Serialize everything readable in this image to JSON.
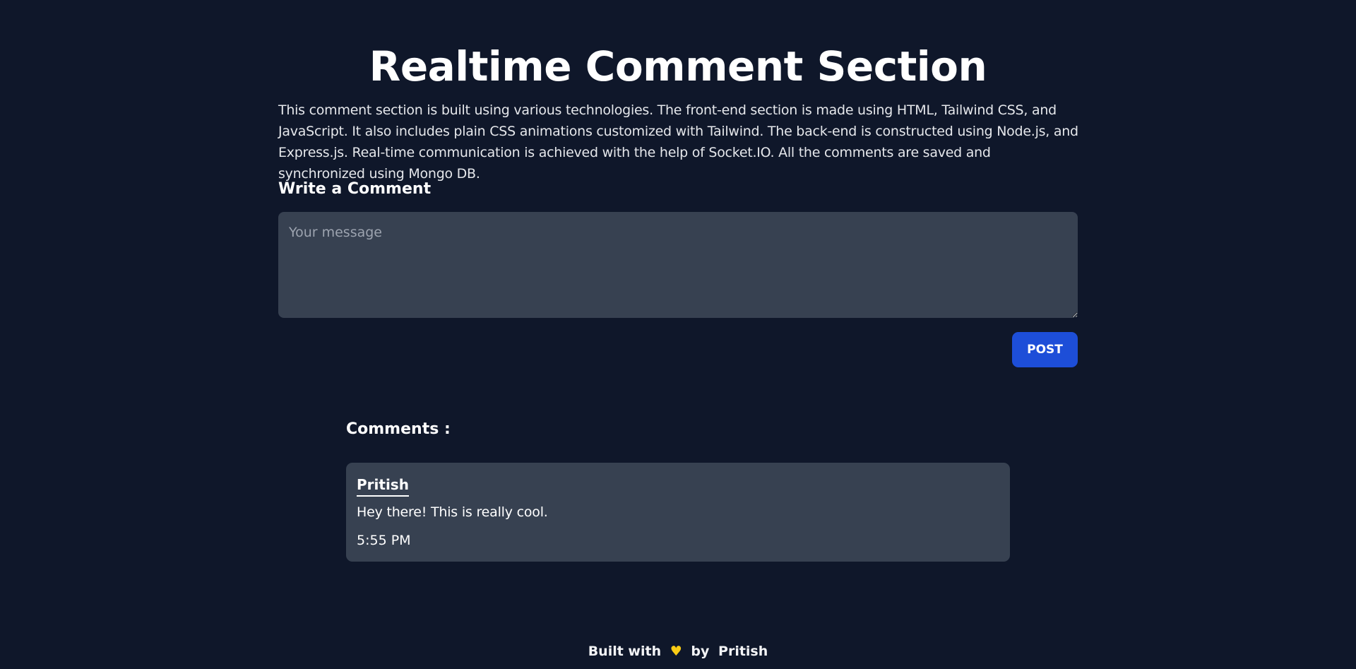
{
  "header": {
    "title": "Realtime Comment Section",
    "description": "This comment section is built using various technologies. The front-end section is made using HTML, Tailwind CSS, and JavaScript. It also includes plain CSS animations customized with Tailwind. The back-end is constructed using Node.js, and Express.js. Real-time communication is achieved with the help of Socket.IO. All the comments are saved and synchronized using Mongo DB."
  },
  "compose": {
    "heading": "Write a Comment",
    "placeholder": "Your message",
    "value": "",
    "post_label": "POST"
  },
  "comments": {
    "heading": "Comments :",
    "items": [
      {
        "author": "Pritish",
        "text": "Hey there! This is really cool.",
        "time": "5:55 PM"
      }
    ]
  },
  "footer": {
    "built_with": "Built with",
    "heart_icon": "heart-icon",
    "by": "by",
    "author": "Pritish"
  },
  "colors": {
    "background": "#0f172a",
    "surface": "#374151",
    "accent": "#1d4ed8",
    "heart": "#facc15"
  }
}
